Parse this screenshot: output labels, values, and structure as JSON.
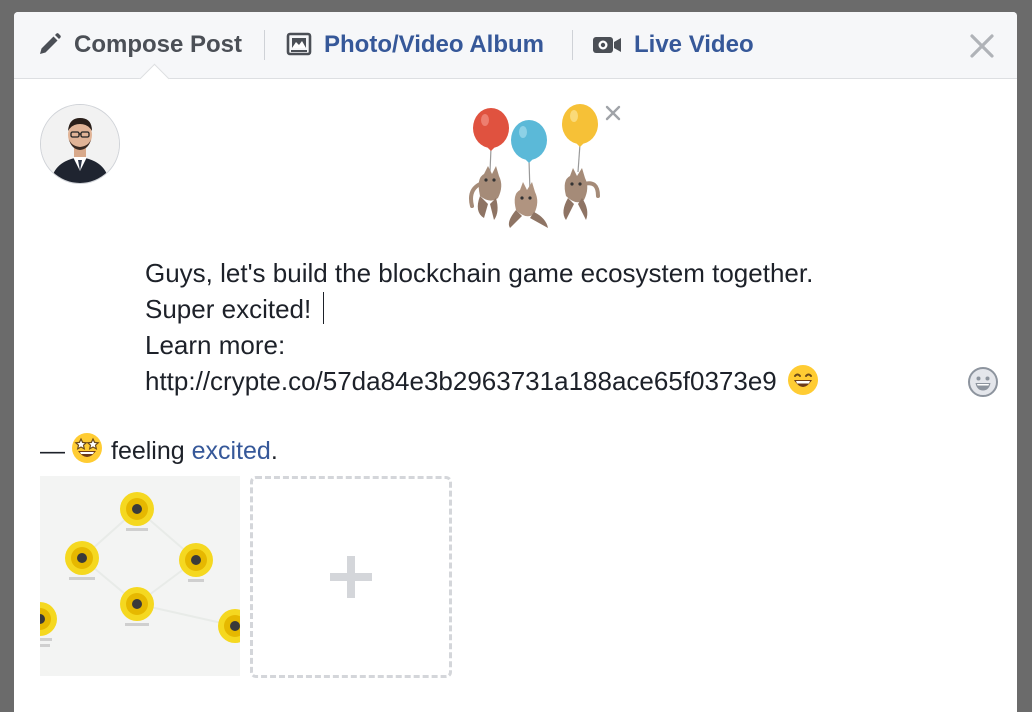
{
  "tabs": {
    "compose": {
      "label": "Compose Post",
      "icon": "pencil-icon"
    },
    "photo": {
      "label": "Photo/Video Album",
      "icon": "photo-album-icon"
    },
    "live": {
      "label": "Live Video",
      "icon": "video-camera-icon"
    }
  },
  "post": {
    "lines": [
      "Guys, let's build the blockchain game ecosystem together.",
      "Super excited!",
      "Learn more:",
      "http://crypte.co/57da84e3b2963731a188ace65f0373e9"
    ]
  },
  "feeling": {
    "dash": "—",
    "prefix": "feeling",
    "activity": "excited",
    "suffix": "."
  },
  "colors": {
    "link_blue": "#365899",
    "text": "#1d2129",
    "tab_gray": "#4b4f56",
    "backdrop": "#6b6b6b"
  },
  "icons": [
    "pencil-icon",
    "photo-album-icon",
    "video-camera-icon",
    "close-icon",
    "balloon-cats-sticker",
    "smile-emoji-icon",
    "emoji-picker-icon",
    "star-struck-emoji-icon",
    "plus-icon"
  ]
}
